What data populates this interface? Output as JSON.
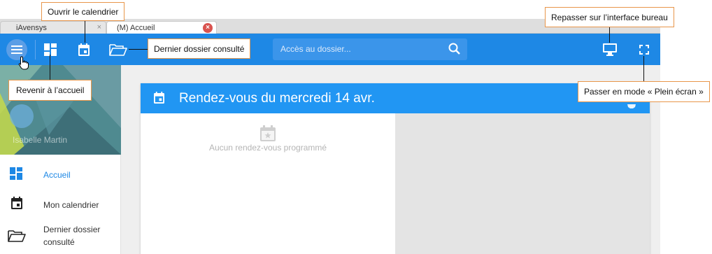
{
  "browser": {
    "tabs": [
      {
        "label": "iAvensys",
        "close": "×"
      },
      {
        "label": "(M) Accueil",
        "close": "×"
      }
    ]
  },
  "appbar": {
    "search_placeholder": "Accès au dossier...",
    "icons": [
      "menu-icon",
      "dashboard-icon",
      "calendar-icon",
      "folder-open-icon",
      "search-icon",
      "desktop-monitor-icon",
      "fullscreen-icon"
    ],
    "accent_color": "#1e88e5"
  },
  "sidebar": {
    "user_name": "Isabelle Martin",
    "items": [
      {
        "label": "Accueil",
        "icon": "dashboard-icon",
        "active": true
      },
      {
        "label": "Mon calendrier",
        "icon": "calendar-icon",
        "active": false
      },
      {
        "label": "Dernier dossier",
        "label2": "consulté",
        "icon": "folder-open-icon",
        "active": false
      }
    ]
  },
  "main": {
    "card_title": "Rendez-vous du mercredi 14 avr.",
    "empty_text": "Aucun rendez-vous programmé",
    "header_color": "#2196f3"
  },
  "callouts": {
    "calendar": "Ouvrir le calendrier",
    "last_folder": "Dernier dossier consulté",
    "home": "Revenir à l’accueil",
    "desktop": "Repasser sur l’interface bureau",
    "fullscreen": "Passer en mode « Plein écran »",
    "border_color": "#e8964a"
  }
}
